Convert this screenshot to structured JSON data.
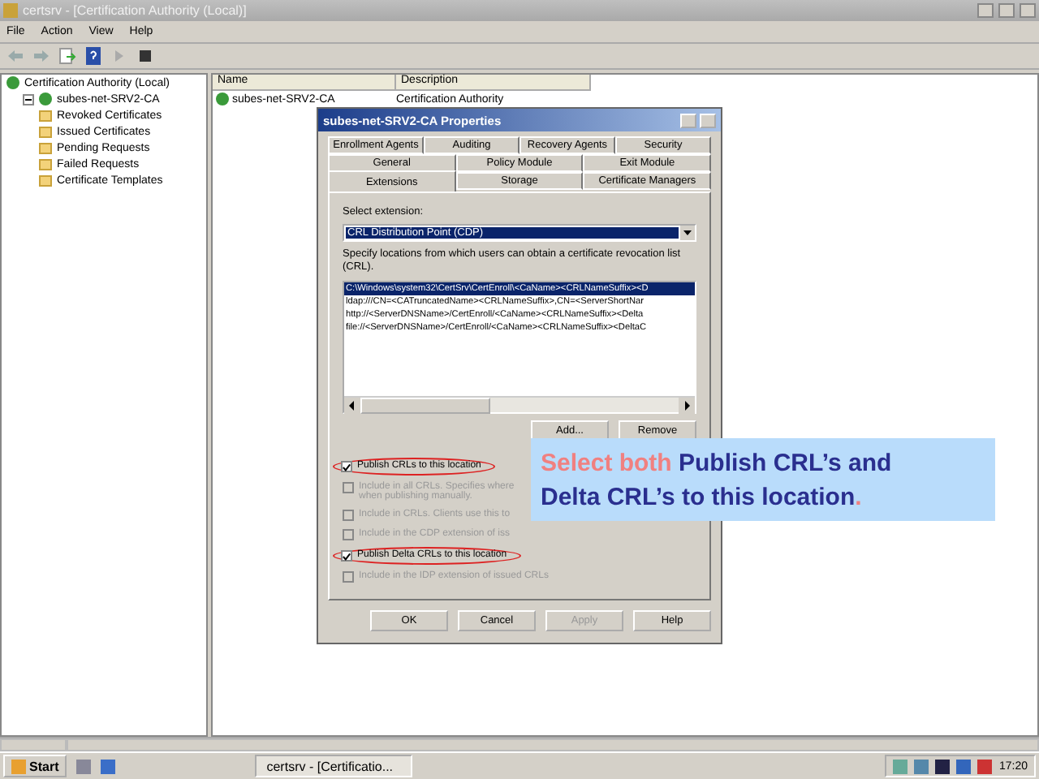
{
  "window": {
    "title": "certsrv - [Certification Authority (Local)]"
  },
  "menu": [
    "File",
    "Action",
    "View",
    "Help"
  ],
  "tree": {
    "label": "Certification Authority (Local)",
    "children": [
      {
        "label": "subes-net-SRV2-CA",
        "expanded": true,
        "children": [
          {
            "label": "Revoked Certificates"
          },
          {
            "label": "Issued Certificates"
          },
          {
            "label": "Pending Requests"
          },
          {
            "label": "Failed Requests"
          },
          {
            "label": "Certificate Templates"
          }
        ]
      }
    ]
  },
  "list": {
    "columns": [
      "Name",
      "Description"
    ],
    "rows": [
      {
        "name": "subes-net-SRV2-CA",
        "description": "Certification Authority"
      }
    ]
  },
  "dialog": {
    "title": "subes-net-SRV2-CA Properties",
    "tab_rows": [
      [
        {
          "label": "Enrollment Agents",
          "selected": false
        },
        {
          "label": "Auditing",
          "selected": false
        },
        {
          "label": "Recovery Agents",
          "selected": false
        },
        {
          "label": "Security",
          "selected": false
        }
      ],
      [
        {
          "label": "General",
          "selected": false
        },
        {
          "label": "Policy Module",
          "selected": false
        },
        {
          "label": "Exit Module",
          "selected": false
        }
      ],
      [
        {
          "label": "Extensions",
          "selected": true
        },
        {
          "label": "Storage",
          "selected": false
        },
        {
          "label": "Certificate Managers",
          "selected": false
        }
      ]
    ],
    "select_label": "Select extension:",
    "select_value": "CRL Distribution Point (CDP)",
    "description": "Specify locations from which users can obtain a certificate revocation list (CRL).",
    "locations": [
      {
        "text": "C:\\Windows\\system32\\CertSrv\\CertEnroll\\<CaName><CRLNameSuffix><D",
        "selected": true
      },
      {
        "text": "ldap:///CN=<CATruncatedName><CRLNameSuffix>,CN=<ServerShortNar",
        "selected": false
      },
      {
        "text": "http://<ServerDNSName>/CertEnroll/<CaName><CRLNameSuffix><Delta",
        "selected": false
      },
      {
        "text": "file://<ServerDNSName>/CertEnroll/<CaName><CRLNameSuffix><DeltaC",
        "selected": false
      }
    ],
    "location_buttons": [
      "Add...",
      "Remove"
    ],
    "options": [
      {
        "label": "Publish CRLs to this location",
        "checked": true,
        "disabled": false,
        "circled": true
      },
      {
        "label": "Include in all CRLs. Specifies where",
        "label_2": "when publishing manually.",
        "checked": false,
        "disabled": true,
        "circled": false
      },
      {
        "label": "Include in CRLs. Clients use this to",
        "checked": false,
        "disabled": true,
        "circled": false
      },
      {
        "label": "Include in the CDP extension of iss",
        "checked": false,
        "disabled": true,
        "circled": false
      },
      {
        "label": "Publish Delta CRLs to this location",
        "checked": true,
        "disabled": false,
        "circled": true
      },
      {
        "label": "Include in the IDP extension of issued CRLs",
        "checked": false,
        "disabled": true,
        "circled": false
      }
    ],
    "buttons": [
      {
        "label": "OK",
        "disabled": false
      },
      {
        "label": "Cancel",
        "disabled": false
      },
      {
        "label": "Apply",
        "disabled": true
      },
      {
        "label": "Help",
        "disabled": false
      }
    ]
  },
  "callout": {
    "lines": [
      [
        {
          "text": "Select both ",
          "color": "#f08080"
        },
        {
          "text": "Publish CRL’s and",
          "color": "#2a2f8f"
        }
      ],
      [
        {
          "text": "Delta CRL’s to this location",
          "color": "#2a2f8f"
        },
        {
          "text": ".",
          "color": "#f08080"
        }
      ]
    ]
  },
  "taskbar": {
    "start": "Start",
    "task": "certsrv - [Certificatio...",
    "clock": "17:20"
  }
}
